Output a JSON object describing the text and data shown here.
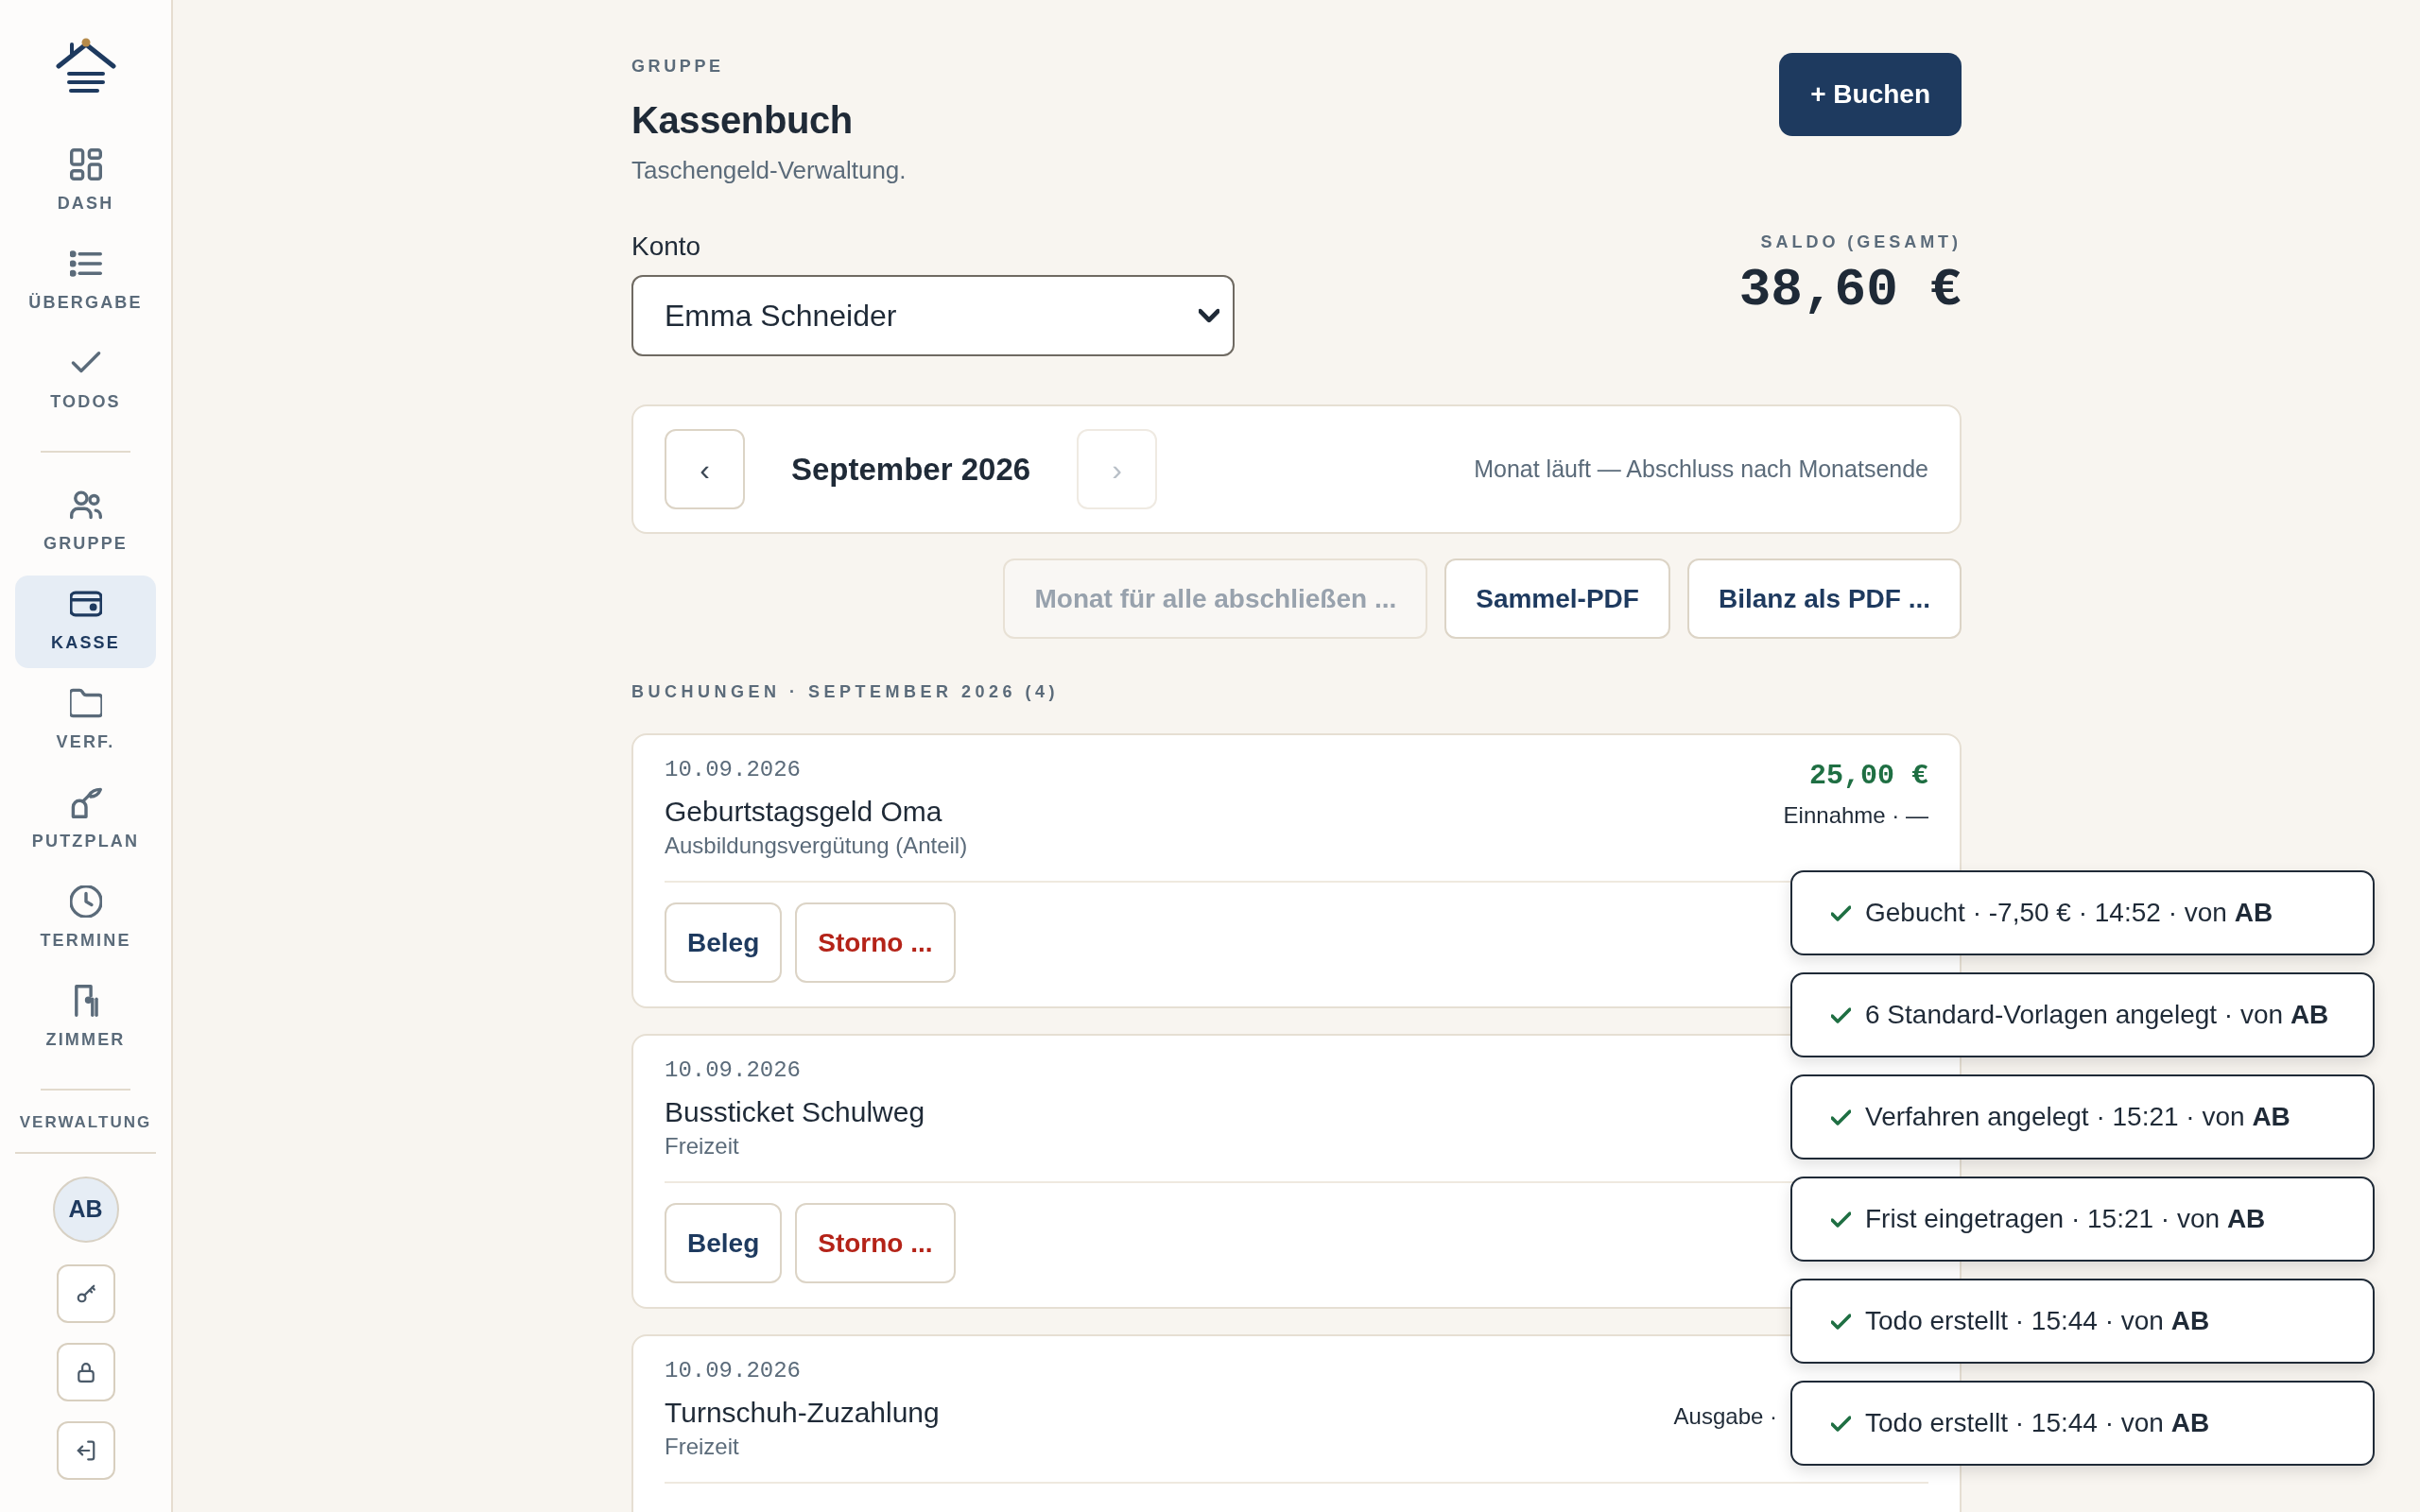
{
  "sidebar": {
    "sections": [
      {
        "items": [
          {
            "label": "DASH",
            "selected": false
          },
          {
            "label": "ÜBERGABE",
            "selected": false
          },
          {
            "label": "TODOS",
            "selected": false
          }
        ]
      },
      {
        "items": [
          {
            "label": "GRUPPE",
            "selected": false
          },
          {
            "label": "KASSE",
            "selected": true
          },
          {
            "label": "VERF.",
            "selected": false
          },
          {
            "label": "PUTZPLAN",
            "selected": false
          },
          {
            "label": "TERMINE",
            "selected": false
          },
          {
            "label": "ZIMMER",
            "selected": false
          }
        ]
      }
    ],
    "admin_label": "VERWALTUNG",
    "avatar": "AB"
  },
  "header": {
    "eyebrow": "GRUPPE",
    "title": "Kassenbuch",
    "subtitle": "Taschengeld-Verwaltung.",
    "primary_button": "+ Buchen"
  },
  "account": {
    "label": "Konto",
    "value": "Emma Schneider"
  },
  "balance": {
    "label": "SALDO (GESAMT)",
    "value": "38,60 €"
  },
  "month_nav": {
    "prev": {
      "label": "‹",
      "disabled": false
    },
    "month": "September 2026",
    "next": {
      "label": "›",
      "disabled": true
    },
    "status": "Monat läuft — Abschluss nach Monatsende"
  },
  "actions": [
    {
      "label": "Monat für alle abschließen ...",
      "disabled": true
    },
    {
      "label": "Sammel-PDF",
      "disabled": false
    },
    {
      "label": "Bilanz als PDF ...",
      "disabled": false
    }
  ],
  "bookings": {
    "heading": "BUCHUNGEN · SEPTEMBER 2026 (4)",
    "items": [
      {
        "date": "10.09.2026",
        "title": "Geburtstagsgeld Oma",
        "category": "Ausbildungsvergütung (Anteil)",
        "amount": {
          "value": "25,00 €",
          "kind": "income"
        },
        "type": "Einnahme · —",
        "buttons": [
          {
            "label": "Beleg",
            "kind": "neutral"
          },
          {
            "label": "Storno ...",
            "kind": "danger"
          }
        ]
      },
      {
        "date": "10.09.2026",
        "title": "Bussticket Schulweg",
        "category": "Freizeit",
        "buttons": [
          {
            "label": "Beleg",
            "kind": "neutral"
          },
          {
            "label": "Storno ...",
            "kind": "danger"
          }
        ]
      },
      {
        "date": "10.09.2026",
        "title": "Turnschuh-Zuzahlung",
        "category": "Freizeit",
        "type": "Ausgabe ·"
      }
    ]
  },
  "toasts": [
    {
      "message": "Gebucht · -7,50 € · 14:52 · von **AB**"
    },
    {
      "message": "6 Standard-Vorlagen angelegt · von **AB**"
    },
    {
      "message": "Verfahren angelegt · 15:21 · von **AB**"
    },
    {
      "message": "Frist eingetragen · 15:21 · von **AB**"
    },
    {
      "message": "Todo erstellt · 15:44 · von **AB**"
    },
    {
      "message": "Todo erstellt · 15:44 · von **AB**"
    }
  ]
}
